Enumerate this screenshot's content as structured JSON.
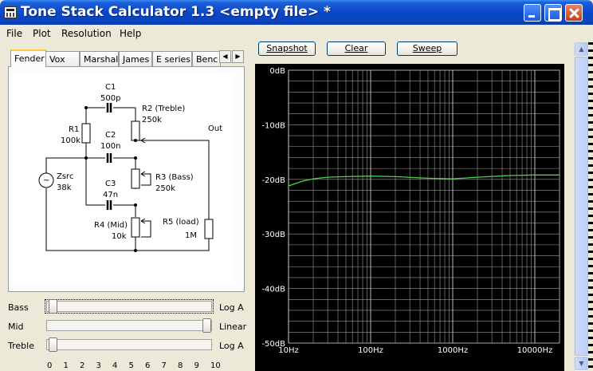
{
  "window": {
    "title": "Tone Stack Calculator 1.3  <empty file> *"
  },
  "menu": [
    "File",
    "Plot",
    "Resolution",
    "Help"
  ],
  "tabs": [
    "Fender",
    "Vox",
    "Marshall",
    "James",
    "E series",
    "Benc"
  ],
  "tab_arrows": [
    "◀",
    "▶"
  ],
  "buttons": {
    "snapshot": "Snapshot",
    "clear": "Clear",
    "sweep": "Sweep"
  },
  "schematic": {
    "c1_name": "C1",
    "c1_value": "500p",
    "r2_name": "R2 (Treble)",
    "r2_value": "250k",
    "out_label": "Out",
    "r1_name": "R1",
    "r1_value": "100k",
    "c2_name": "C2",
    "c2_value": "100n",
    "zsrc_name": "Zsrc",
    "zsrc_value": "38k",
    "c3_name": "C3",
    "c3_value": "47n",
    "r3_name": "R3 (Bass)",
    "r3_value": "250k",
    "r4_name": "R4 (Mid)",
    "r4_value": "10k",
    "r5_name": "R5 (load)",
    "r5_value": "1M",
    "source_symbol": "~"
  },
  "controls": {
    "bass": {
      "label": "Bass",
      "taper": "Log A",
      "value": 0
    },
    "mid": {
      "label": "Mid",
      "taper": "Linear",
      "value": 10
    },
    "treble": {
      "label": "Treble",
      "taper": "Log A",
      "value": 0
    },
    "scale": [
      "0",
      "1",
      "2",
      "3",
      "4",
      "5",
      "6",
      "7",
      "8",
      "9",
      "10"
    ]
  },
  "chart_data": {
    "type": "line",
    "x_scale": "log",
    "xlim": [
      10,
      20000
    ],
    "ylim": [
      -50,
      0
    ],
    "grid": true,
    "y_ticks": [
      "0dB",
      "-10dB",
      "-20dB",
      "-30dB",
      "-40dB",
      "-50dB"
    ],
    "y_tick_values": [
      0,
      -10,
      -20,
      -30,
      -40,
      -50
    ],
    "x_ticks": [
      "10Hz",
      "100Hz",
      "1000Hz",
      "10000Hz"
    ],
    "x_tick_values": [
      10,
      100,
      1000,
      10000
    ],
    "series": [
      {
        "color": "#4fd04f",
        "x": [
          10,
          12,
          15,
          20,
          30,
          50,
          100,
          200,
          500,
          1000,
          2000,
          5000,
          10000,
          20000
        ],
        "y": [
          -21.2,
          -20.8,
          -20.3,
          -19.9,
          -19.6,
          -19.5,
          -19.4,
          -19.5,
          -19.8,
          -19.9,
          -19.6,
          -19.3,
          -19.2,
          -19.2
        ]
      }
    ]
  }
}
